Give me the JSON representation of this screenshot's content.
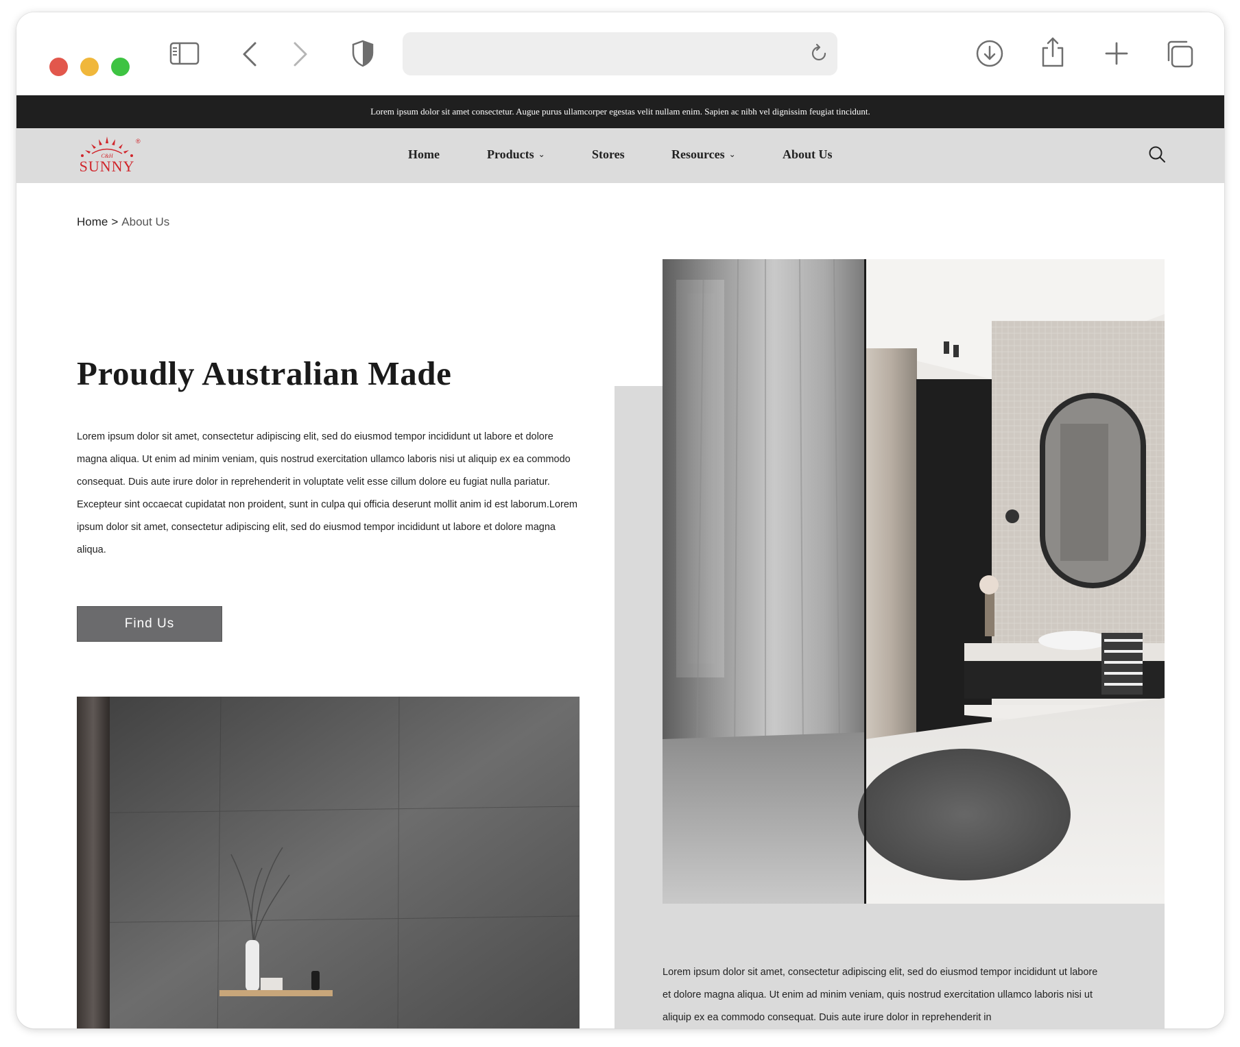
{
  "browser": {
    "controls": [
      "close",
      "minimize",
      "maximize"
    ],
    "icons": [
      "sidebar-icon",
      "back-icon",
      "forward-icon",
      "shield-icon",
      "reload-icon",
      "download-icon",
      "share-icon",
      "new-tab-icon",
      "tabs-icon"
    ],
    "address": ""
  },
  "announcement": "Lorem ipsum dolor sit amet consectetur. Augue purus ullamcorper egestas velit nullam enim. Sapien ac nibh vel dignissim feugiat tincidunt.",
  "logo": {
    "brand": "SUNNY",
    "small_text": "C&H",
    "registered": "®"
  },
  "nav": {
    "items": [
      {
        "label": "Home",
        "dropdown": false
      },
      {
        "label": "Products",
        "dropdown": true
      },
      {
        "label": "Stores",
        "dropdown": false
      },
      {
        "label": "Resources",
        "dropdown": true
      },
      {
        "label": "About Us",
        "dropdown": false
      }
    ],
    "caret": "⌄"
  },
  "breadcrumb": {
    "home": "Home",
    "separator": ">",
    "current": "About Us"
  },
  "main": {
    "heading": "Proudly Australian Made",
    "body": "Lorem ipsum dolor sit amet, consectetur adipiscing elit, sed do eiusmod tempor incididunt ut labore et dolore magna aliqua. Ut enim ad minim veniam, quis nostrud exercitation ullamco laboris nisi ut aliquip ex ea commodo consequat. Duis aute irure dolor in reprehenderit in voluptate velit esse cillum dolore eu fugiat nulla pariatur. Excepteur sint occaecat cupidatat non proident, sunt in culpa qui officia deserunt mollit anim id est laborum.Lorem ipsum dolor sit amet, consectetur adipiscing elit, sed do eiusmod tempor incididunt ut labore et dolore magna aliqua.",
    "button": "Find Us"
  },
  "panel": {
    "body": "Lorem ipsum dolor sit amet, consectetur adipiscing elit, sed do eiusmod tempor incididunt ut labore et dolore magna aliqua. Ut enim ad minim veniam, quis nostrud exercitation ullamco laboris nisi ut aliquip ex ea commodo consequat. Duis aute irure dolor in reprehenderit in"
  },
  "colors": {
    "announcement_bg": "#1f1f1f",
    "nav_bg": "#dcdcdc",
    "button_bg": "#6b6b6d",
    "panel_bg": "#dadada",
    "logo_red": "#d0252b"
  }
}
